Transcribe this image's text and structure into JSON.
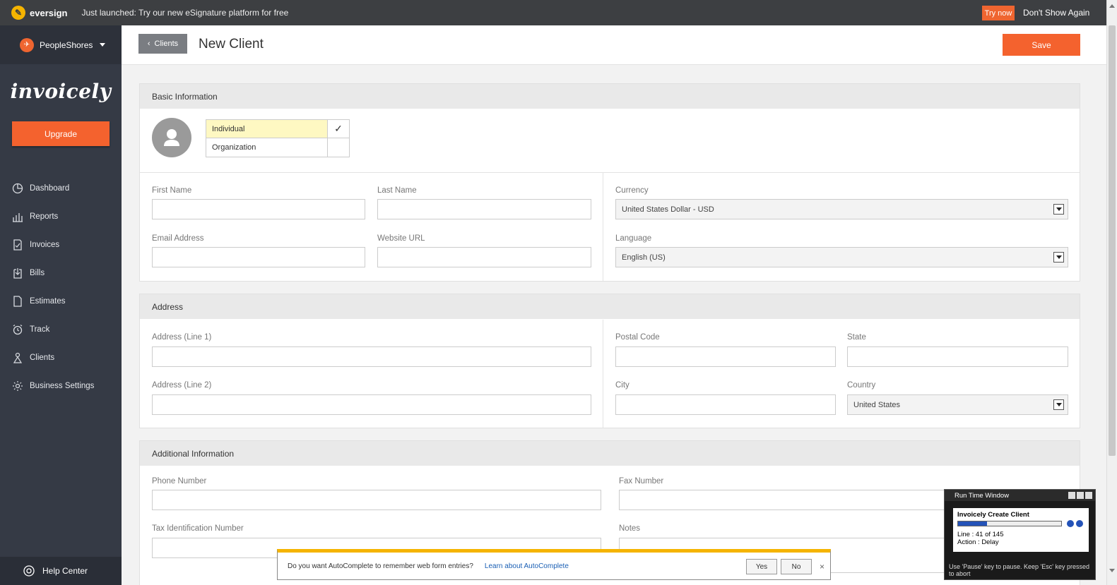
{
  "banner": {
    "brand": "eversign",
    "message": "Just launched: Try our new eSignature platform for free",
    "try_label": "Try now",
    "dismiss_label": "Don't Show Again"
  },
  "sidebar": {
    "account_name": "PeopleShores",
    "logo": "invoicely",
    "upgrade_label": "Upgrade",
    "items": [
      {
        "label": "Dashboard",
        "icon": "dashboard-icon"
      },
      {
        "label": "Reports",
        "icon": "reports-icon"
      },
      {
        "label": "Invoices",
        "icon": "invoices-icon"
      },
      {
        "label": "Bills",
        "icon": "bills-icon"
      },
      {
        "label": "Estimates",
        "icon": "estimates-icon"
      },
      {
        "label": "Track",
        "icon": "track-icon"
      },
      {
        "label": "Clients",
        "icon": "clients-icon"
      },
      {
        "label": "Business Settings",
        "icon": "settings-icon"
      }
    ],
    "help_label": "Help Center"
  },
  "header": {
    "back_label": "Clients",
    "title": "New Client",
    "save_label": "Save"
  },
  "basic": {
    "heading": "Basic Information",
    "types": [
      {
        "label": "Individual",
        "checked": "✓"
      },
      {
        "label": "Organization",
        "checked": ""
      }
    ],
    "first_name_label": "First Name",
    "last_name_label": "Last Name",
    "email_label": "Email Address",
    "website_label": "Website URL",
    "currency_label": "Currency",
    "currency_value": "United States Dollar - USD",
    "language_label": "Language",
    "language_value": "English (US)"
  },
  "address": {
    "heading": "Address",
    "line1_label": "Address (Line 1)",
    "line2_label": "Address (Line 2)",
    "postal_label": "Postal Code",
    "state_label": "State",
    "city_label": "City",
    "country_label": "Country",
    "country_value": "United States"
  },
  "additional": {
    "heading": "Additional Information",
    "phone_label": "Phone Number",
    "fax_label": "Fax Number",
    "tax_label": "Tax Identification Number",
    "notes_label": "Notes"
  },
  "autocomplete": {
    "question": "Do you want AutoComplete to remember web form entries?",
    "learn_label": "Learn about AutoComplete",
    "yes_label": "Yes",
    "no_label": "No",
    "close_glyph": "×"
  },
  "runtime": {
    "title": "Run Time Window",
    "task": "Invoicely Create Client",
    "progress": 0.28,
    "line_text": "Line : 41 of 145",
    "action_text": "Action : Delay",
    "hint": "Use 'Pause' key to pause. Keep 'Esc' key pressed to abort"
  },
  "colors": {
    "accent": "#f4622e",
    "sidebar": "#353a45",
    "banner": "#3d3f42"
  }
}
